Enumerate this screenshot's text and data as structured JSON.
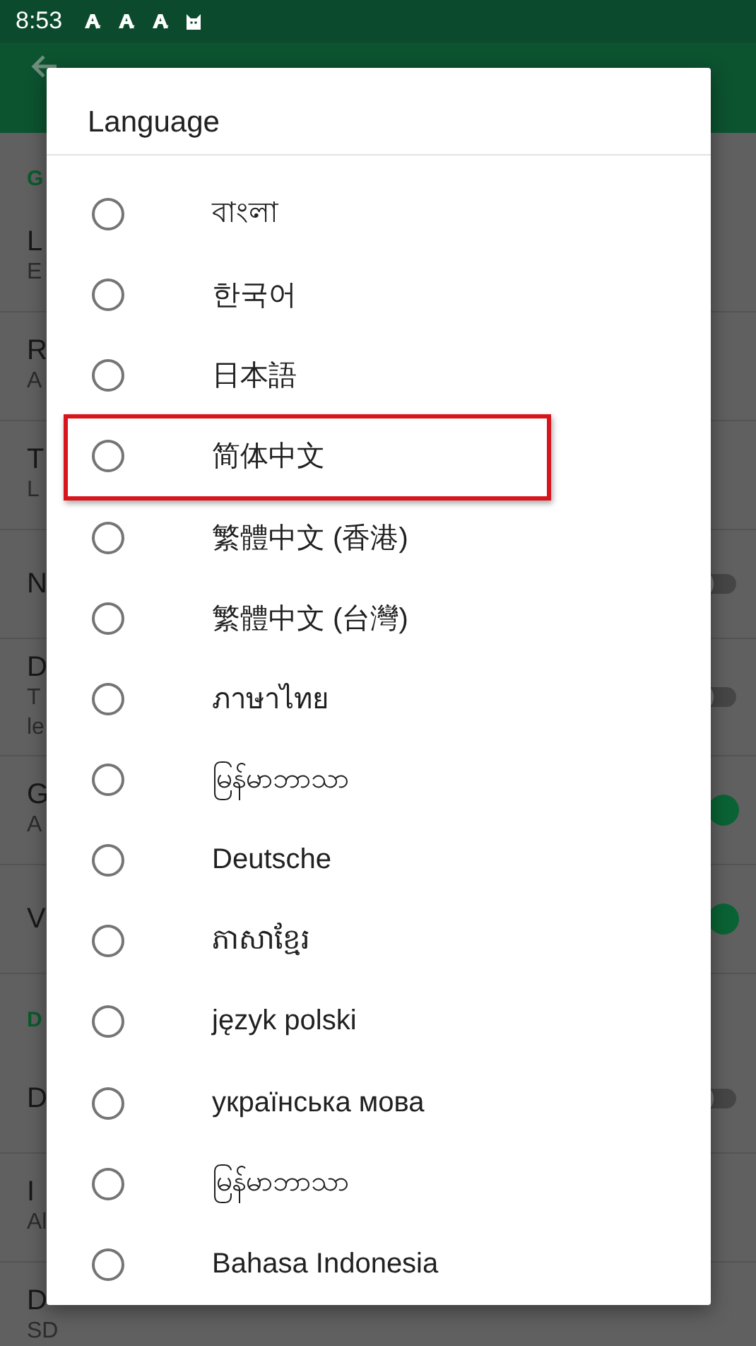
{
  "status_bar": {
    "time": "8:53",
    "notifications": [
      {
        "kind": "letter"
      },
      {
        "kind": "letter"
      },
      {
        "kind": "letter"
      },
      {
        "kind": "cat"
      }
    ]
  },
  "settings": [
    {
      "kind": "header",
      "title": "G"
    },
    {
      "kind": "item",
      "title": "L",
      "summary": "E"
    },
    {
      "kind": "item",
      "title": "R",
      "summary": "A"
    },
    {
      "kind": "item",
      "title": "T",
      "summary": "L"
    },
    {
      "kind": "switch",
      "title": "N",
      "on": false
    },
    {
      "kind": "switch",
      "title": "D",
      "summary": "T\nle",
      "on": false
    },
    {
      "kind": "switch",
      "title": "G",
      "summary": "A",
      "on": true
    },
    {
      "kind": "switch",
      "title": "V",
      "on": true
    },
    {
      "kind": "header",
      "title": "D"
    },
    {
      "kind": "switch",
      "title": "D",
      "on": false
    },
    {
      "kind": "item",
      "title": "I",
      "summary": "Al"
    },
    {
      "kind": "item",
      "title": "D",
      "summary": "SD"
    }
  ],
  "dialog": {
    "title": "Language",
    "options": [
      {
        "label": "বাংলা",
        "selected": false,
        "highlighted": false
      },
      {
        "label": "한국어",
        "selected": false,
        "highlighted": false
      },
      {
        "label": "日本語",
        "selected": false,
        "highlighted": false
      },
      {
        "label": "简体中文",
        "selected": false,
        "highlighted": true
      },
      {
        "label": "繁體中文 (香港)",
        "selected": false,
        "highlighted": false
      },
      {
        "label": "繁體中文 (台灣)",
        "selected": false,
        "highlighted": false
      },
      {
        "label": "ภาษาไทย",
        "selected": false,
        "highlighted": false
      },
      {
        "label": "မြန်မာဘာသာ",
        "selected": false,
        "highlighted": false
      },
      {
        "label": "Deutsche",
        "selected": false,
        "highlighted": false
      },
      {
        "label": "ភាសាខ្មែរ",
        "selected": false,
        "highlighted": false
      },
      {
        "label": "język polski",
        "selected": false,
        "highlighted": false
      },
      {
        "label": "українська мова",
        "selected": false,
        "highlighted": false
      },
      {
        "label": "မြန်မာဘာသာ",
        "selected": false,
        "highlighted": false
      },
      {
        "label": "Bahasa Indonesia",
        "selected": false,
        "highlighted": false
      }
    ]
  }
}
